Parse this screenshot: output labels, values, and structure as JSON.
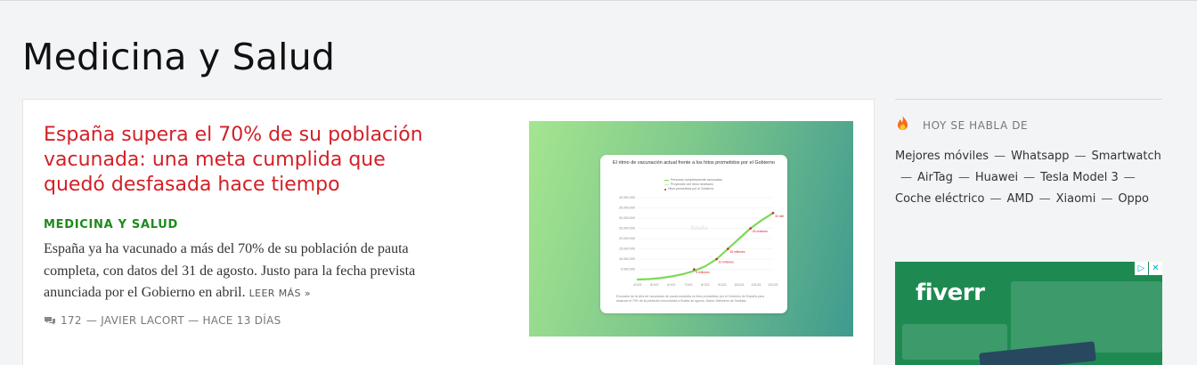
{
  "page": {
    "title": "Medicina y Salud"
  },
  "article": {
    "title": "España supera el 70% de su población vacunada: una meta cumplida que quedó desfasada hace tiempo",
    "category": "MEDICINA Y SALUD",
    "summary": "España ya ha vacunado a más del 70% de su población de pauta completa, con datos del 31 de agosto. Justo para la fecha prevista anunciada por el Gobierno en abril.",
    "read_more": "LEER MÁS »",
    "comments": "172",
    "byline": "— JAVIER LACORT — HACE 13 DÍAS"
  },
  "thumbnail": {
    "chart_title": "El ritmo de vacunación actual frente a los hitos prometidos por el Gobierno",
    "legend": [
      "Personas completamente vacunadas",
      "Proyección del ritmo necesario",
      "Hitos prometidos por el Gobierno"
    ],
    "watermark": "Xataka",
    "footnote": "Evolución de la cifra de vacunados de pauta completa vs hitos prometidos por el Gobierno de España para alcanzar el 70% de la población inmunizada a finales de agosto. Datos: Ministerio de Sanidad."
  },
  "chart_data": {
    "type": "line",
    "title": "El ritmo de vacunación actual frente a los hitos prometidos por el Gobierno",
    "ylim": [
      0,
      40000000
    ],
    "yticks": [
      "40.000.000",
      "35.000.000",
      "30.000.000",
      "25.000.000",
      "20.000.000",
      "15.000.000",
      "10.000.000",
      "5.000.000"
    ],
    "x_ticks": [
      "4/1/21",
      "5/1/21",
      "6/1/21",
      "7/1/21",
      "8/1/21",
      "9/1/21",
      "10/1/21",
      "11/1/21",
      "12/1/21"
    ],
    "series": [
      {
        "name": "Personas completamente vacunadas",
        "color": "#7ed957",
        "values": [
          0,
          200000,
          700000,
          1500000,
          2600000,
          4200000,
          6500000,
          10000000,
          15000000,
          20000000,
          25000000,
          29000000,
          32500000
        ]
      }
    ],
    "milestones": [
      {
        "label": "5 millones",
        "value": 5000000,
        "index": 5
      },
      {
        "label": "10 millones",
        "value": 10000000,
        "index": 7
      },
      {
        "label": "15 millones",
        "value": 15000000,
        "index": 8
      },
      {
        "label": "25 millones",
        "value": 25000000,
        "index": 10
      },
      {
        "label": "33 millones",
        "value": 32500000,
        "index": 12
      }
    ]
  },
  "sidebar": {
    "trending_label": "HOY SE HABLA DE",
    "trends": [
      "Mejores móviles",
      "Whatsapp",
      "Smartwatch",
      "AirTag",
      "Huawei",
      "Tesla Model 3",
      "Coche eléctrico",
      "AMD",
      "Xiaomi",
      "Oppo"
    ],
    "ad_brand": "fiverr"
  },
  "colors": {
    "headline": "#d32027",
    "category": "#1d8a1d",
    "ad_bg": "#1e8a52"
  }
}
